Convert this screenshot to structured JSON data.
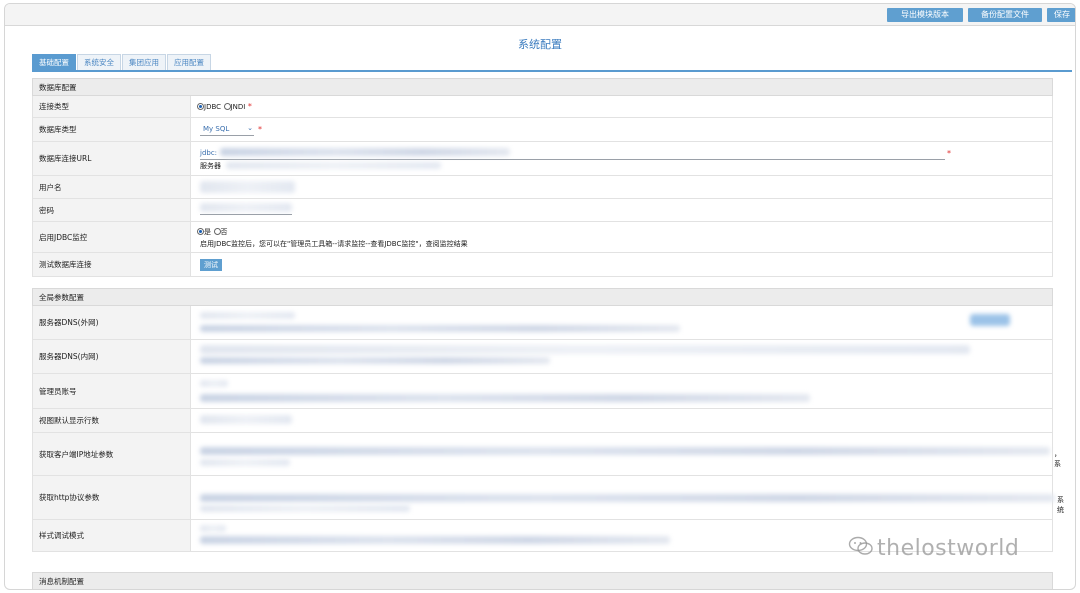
{
  "toolbar": {
    "export_label": "导出模块版本",
    "backup_label": "备份配置文件",
    "save_label": "保存"
  },
  "page": {
    "title": "系统配置"
  },
  "tabs": [
    {
      "label": "基础配置",
      "active": true
    },
    {
      "label": "系统安全",
      "active": false
    },
    {
      "label": "集团应用",
      "active": false
    },
    {
      "label": "应用配置",
      "active": false
    }
  ],
  "db_section": {
    "title": "数据库配置",
    "conn_type": {
      "label": "连接类型",
      "options": [
        "JDBC",
        "JNDI"
      ],
      "selected": "JDBC",
      "required": "*"
    },
    "db_type": {
      "label": "数据库类型",
      "value": "My SQL",
      "required": "*"
    },
    "db_url": {
      "label": "数据库连接URL",
      "value_prefix": "jdbc:",
      "hint_prefix": "服务器",
      "required": "*"
    },
    "user": {
      "label": "用户名"
    },
    "password": {
      "label": "密码"
    },
    "jdbc_monitor": {
      "label": "启用JDBC监控",
      "options": [
        "是",
        "否"
      ],
      "selected": "是",
      "hint": "启用JDBC监控后，您可以在\"管理员工具箱--请求监控--查看JDBC监控\"，查阅监控结果"
    },
    "test_conn": {
      "label": "测试数据库连接",
      "button": "测试"
    }
  },
  "global_section": {
    "title": "全局参数配置",
    "rows": [
      {
        "label": "服务器DNS(外网)"
      },
      {
        "label": "服务器DNS(内网)"
      },
      {
        "label": "管理员账号"
      },
      {
        "label": "视图默认显示行数"
      },
      {
        "label": "获取客户端IP地址参数",
        "tail": "，系"
      },
      {
        "label": "获取http协议参数",
        "tail": "系统"
      },
      {
        "label": "样式调试模式"
      }
    ]
  },
  "msg_section": {
    "title": "消息机制配置"
  },
  "watermark": {
    "text": "thelostworld",
    "icon": "wechat-icon"
  }
}
